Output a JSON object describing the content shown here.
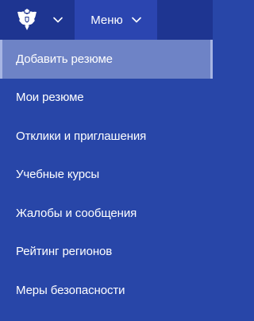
{
  "header": {
    "emblem_icon": "coat-of-arms-icon",
    "menu_label": "Меню"
  },
  "menu": {
    "items": [
      {
        "label": "Добавить резюме",
        "active": true
      },
      {
        "label": "Мои резюме"
      },
      {
        "label": "Отклики и приглашения"
      },
      {
        "label": "Учебные курсы"
      },
      {
        "label": "Жалобы и сообщения"
      },
      {
        "label": "Рейтинг регионов"
      },
      {
        "label": "Меры безопасности"
      }
    ]
  },
  "colors": {
    "header_bg": "#1e3591",
    "menu_button_bg": "#2b45b0",
    "menu_bg": "#2846a8",
    "active_item_bg": "#6e83c6",
    "text": "#ffffff"
  }
}
